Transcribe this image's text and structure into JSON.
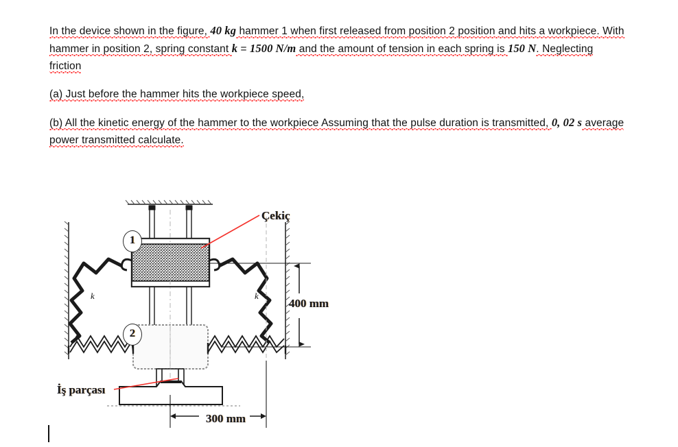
{
  "document": {
    "paragraphs": [
      {
        "id": "p1",
        "runs": [
          {
            "t": "In the device shown in the figure, ",
            "style": "normal",
            "squiggle": true
          },
          {
            "t": "40 kg",
            "style": "bold-italic"
          },
          {
            "t": " hammer 1 when first released from position 2 position and hits a workpiece. With hammer in position 2, spring constant ",
            "style": "normal",
            "squiggle": true
          },
          {
            "t": "k",
            "style": "bold-italic"
          },
          {
            "t": " = ",
            "style": "normal"
          },
          {
            "t": "1500 N/m",
            "style": "bold-italic"
          },
          {
            "t": " and the amount of tension in each spring is ",
            "style": "normal",
            "squiggle": true
          },
          {
            "t": "150 N",
            "style": "bold-italic"
          },
          {
            "t": ". Neglecting friction",
            "style": "normal",
            "squiggle": true
          }
        ]
      },
      {
        "id": "p2",
        "runs": [
          {
            "t": "(a) Just before the hammer hits the workpiece speed,",
            "style": "normal",
            "squiggle": true
          }
        ]
      },
      {
        "id": "p3",
        "runs": [
          {
            "t": "(b) All the kinetic energy of the hammer to the workpiece Assuming that the pulse duration is transmitted, ",
            "style": "normal",
            "squiggle": true
          },
          {
            "t": "0, 02 s",
            "style": "bold-italic"
          },
          {
            "t": " average power transmitted calculate.",
            "style": "normal",
            "squiggle": true
          }
        ]
      }
    ]
  },
  "figure": {
    "title_label": "Çekiç",
    "workpiece_label": "İş parçası",
    "dimension_vertical": "400 mm",
    "dimension_horizontal": "300 mm",
    "position_1": "1",
    "position_2": "2",
    "spring_constant_left": "k",
    "spring_constant_right": "k",
    "leader_line_color": "#f4322c",
    "line_color": "#1b1b1b",
    "label_color": "#1a1a1a"
  },
  "editor": {
    "caret_visible": true
  }
}
